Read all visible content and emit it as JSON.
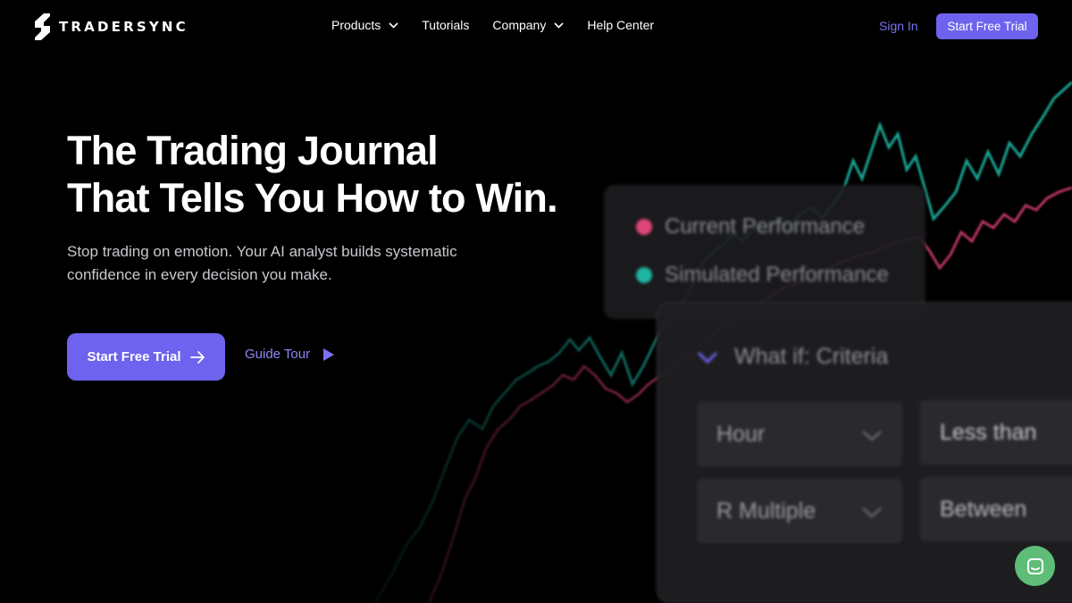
{
  "brand": {
    "name": "TRADERSYNC"
  },
  "nav": {
    "menu": [
      {
        "label": "Products",
        "dropdown": true
      },
      {
        "label": "Tutorials",
        "dropdown": false
      },
      {
        "label": "Company",
        "dropdown": true
      },
      {
        "label": "Help Center",
        "dropdown": false
      }
    ],
    "sign_in": "Sign In",
    "cta": "Start Free Trial"
  },
  "hero": {
    "title_line1": "The Trading Journal",
    "title_line2": "That Tells You How to Win.",
    "subtitle": "Stop trading on emotion. Your AI analyst builds systematic confidence in every decision you make.",
    "primary_cta": "Start Free Trial",
    "secondary_cta": "Guide Tour"
  },
  "legend_card": {
    "items": [
      {
        "label": "Current Performance",
        "color": "#e0457a"
      },
      {
        "label": "Simulated Performance",
        "color": "#1fb5a2"
      }
    ]
  },
  "criteria_card": {
    "title": "What if: Criteria",
    "fields": [
      {
        "label": "Hour"
      },
      {
        "label": "Less than"
      },
      {
        "label": "R Multiple"
      },
      {
        "label": "Between"
      }
    ]
  },
  "colors": {
    "accent": "#6d63ee",
    "link": "#7b73f0",
    "current_line": "#e0457a",
    "simulated_line": "#1fb5a2",
    "chat": "#5fbd78"
  },
  "icons": {
    "logo": "tradersync-logo-icon",
    "dropdown": "chevron-down-icon",
    "cta_arrow": "arrow-right-icon",
    "tour": "play-icon",
    "chat": "chat-icon"
  }
}
